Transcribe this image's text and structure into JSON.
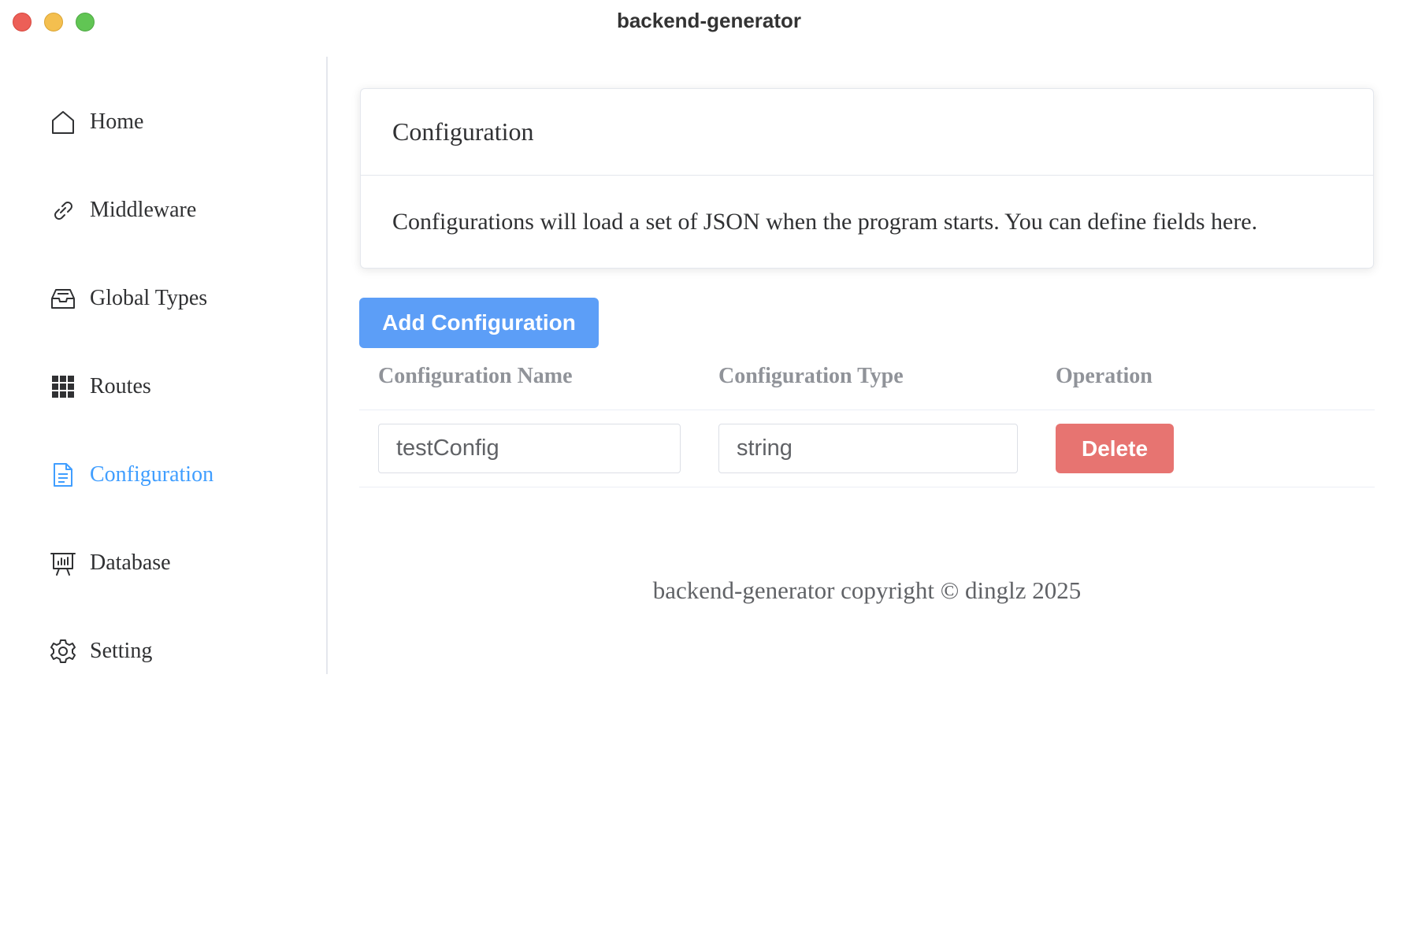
{
  "window": {
    "title": "backend-generator"
  },
  "sidebar": {
    "items": [
      {
        "label": "Home",
        "icon": "home-icon",
        "active": false
      },
      {
        "label": "Middleware",
        "icon": "link-icon",
        "active": false
      },
      {
        "label": "Global Types",
        "icon": "inbox-icon",
        "active": false
      },
      {
        "label": "Routes",
        "icon": "grid-icon",
        "active": false
      },
      {
        "label": "Configuration",
        "icon": "document-icon",
        "active": true
      },
      {
        "label": "Database",
        "icon": "presentation-board-icon",
        "active": false
      },
      {
        "label": "Setting",
        "icon": "gear-icon",
        "active": false
      }
    ]
  },
  "main": {
    "card": {
      "header": "Configuration",
      "description": "Configurations will load a set of JSON when the program starts. You can define fields here."
    },
    "add_button_label": "Add Configuration",
    "table": {
      "headers": [
        "Configuration Name",
        "Configuration Type",
        "Operation"
      ],
      "rows": [
        {
          "name": "testConfig",
          "type": "string",
          "action_label": "Delete"
        }
      ]
    },
    "footer": "backend-generator copyright © dinglz 2025"
  },
  "colors": {
    "accent": "#409eff",
    "primary_button": "#5c9ef7",
    "danger_button": "#e77471",
    "close_light": "#ec5f57",
    "minimize_light": "#f4bf4f",
    "maximize_light": "#61c554"
  }
}
